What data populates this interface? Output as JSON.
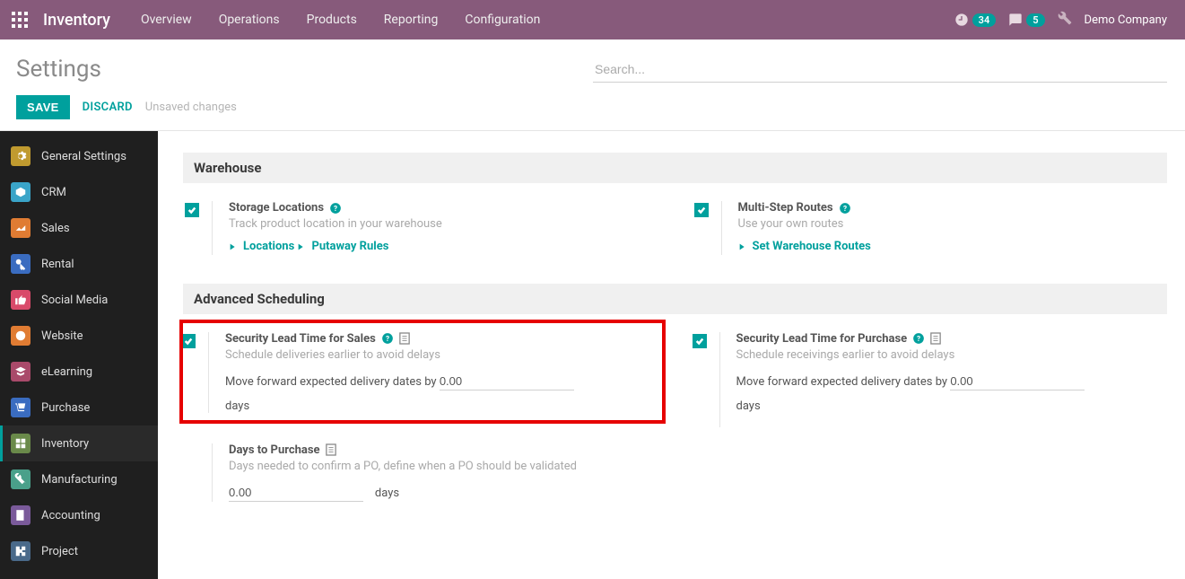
{
  "topbar": {
    "brand": "Inventory",
    "menu": [
      "Overview",
      "Operations",
      "Products",
      "Reporting",
      "Configuration"
    ],
    "activity_count": "34",
    "msg_count": "5",
    "company": "Demo Company"
  },
  "control": {
    "title": "Settings",
    "search_placeholder": "Search...",
    "save": "SAVE",
    "discard": "DISCARD",
    "status": "Unsaved changes"
  },
  "sidebar": {
    "items": [
      {
        "label": "General Settings",
        "color": "#c09a2f"
      },
      {
        "label": "CRM",
        "color": "#3aa4c8"
      },
      {
        "label": "Sales",
        "color": "#e07c33"
      },
      {
        "label": "Rental",
        "color": "#3a6cc0"
      },
      {
        "label": "Social Media",
        "color": "#d94a6a"
      },
      {
        "label": "Website",
        "color": "#e07c33"
      },
      {
        "label": "eLearning",
        "color": "#a94a6a"
      },
      {
        "label": "Purchase",
        "color": "#3a6cc0"
      },
      {
        "label": "Inventory",
        "color": "#6a8a4a"
      },
      {
        "label": "Manufacturing",
        "color": "#4aa08a"
      },
      {
        "label": "Accounting",
        "color": "#7a5a9a"
      },
      {
        "label": "Project",
        "color": "#4a6a8a"
      }
    ]
  },
  "warehouse": {
    "heading": "Warehouse",
    "storage": {
      "title": "Storage Locations",
      "desc": "Track product location in your warehouse",
      "link1": "Locations",
      "link2": "Putaway Rules"
    },
    "routes": {
      "title": "Multi-Step Routes",
      "desc": "Use your own routes",
      "link1": "Set Warehouse Routes"
    }
  },
  "advanced": {
    "heading": "Advanced Scheduling",
    "sales": {
      "title": "Security Lead Time for Sales",
      "desc": "Schedule deliveries earlier to avoid delays",
      "field_label": "Move forward expected delivery dates by",
      "value": "0.00",
      "unit": "days"
    },
    "purchase": {
      "title": "Security Lead Time for Purchase",
      "desc": "Schedule receivings earlier to avoid delays",
      "field_label": "Move forward expected delivery dates by",
      "value": "0.00",
      "unit": "days"
    },
    "days_to_purchase": {
      "title": "Days to Purchase",
      "desc": "Days needed to confirm a PO, define when a PO should be validated",
      "value": "0.00",
      "unit": "days"
    }
  }
}
